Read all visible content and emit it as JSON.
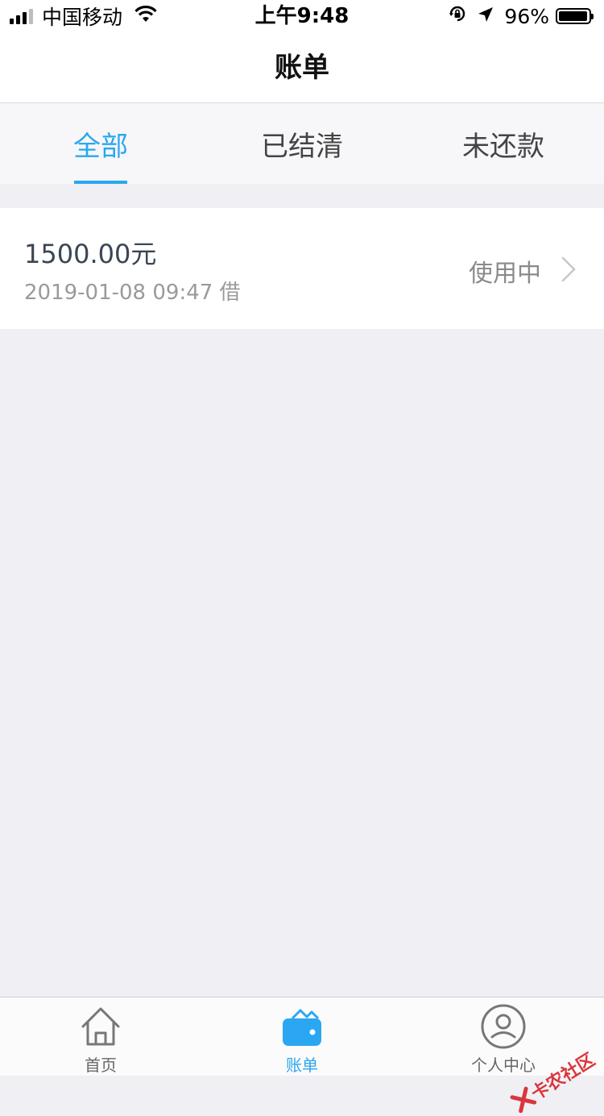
{
  "status_bar": {
    "carrier": "中国移动",
    "time": "上午9:48",
    "battery": "96%",
    "battery_level": 0.96,
    "icons": [
      "signal-icon",
      "wifi-icon",
      "rotation-lock-icon",
      "location-icon",
      "battery-icon"
    ]
  },
  "nav": {
    "title": "账单"
  },
  "tabs": [
    {
      "label": "全部",
      "active": true
    },
    {
      "label": "已结清",
      "active": false
    },
    {
      "label": "未还款",
      "active": false
    }
  ],
  "bills": [
    {
      "amount": "1500.00元",
      "date": "2019-01-08 09:47 借",
      "status": "使用中"
    }
  ],
  "tabbar": [
    {
      "label": "首页",
      "icon": "home-icon",
      "active": false
    },
    {
      "label": "账单",
      "icon": "wallet-icon",
      "active": true
    },
    {
      "label": "个人中心",
      "icon": "user-icon",
      "active": false
    }
  ],
  "watermark": {
    "text": "卡农社区"
  },
  "colors": {
    "accent": "#2aa7f0",
    "background": "#efeff4",
    "amount_text": "#3a4653",
    "secondary_text": "#9a9a9a"
  }
}
